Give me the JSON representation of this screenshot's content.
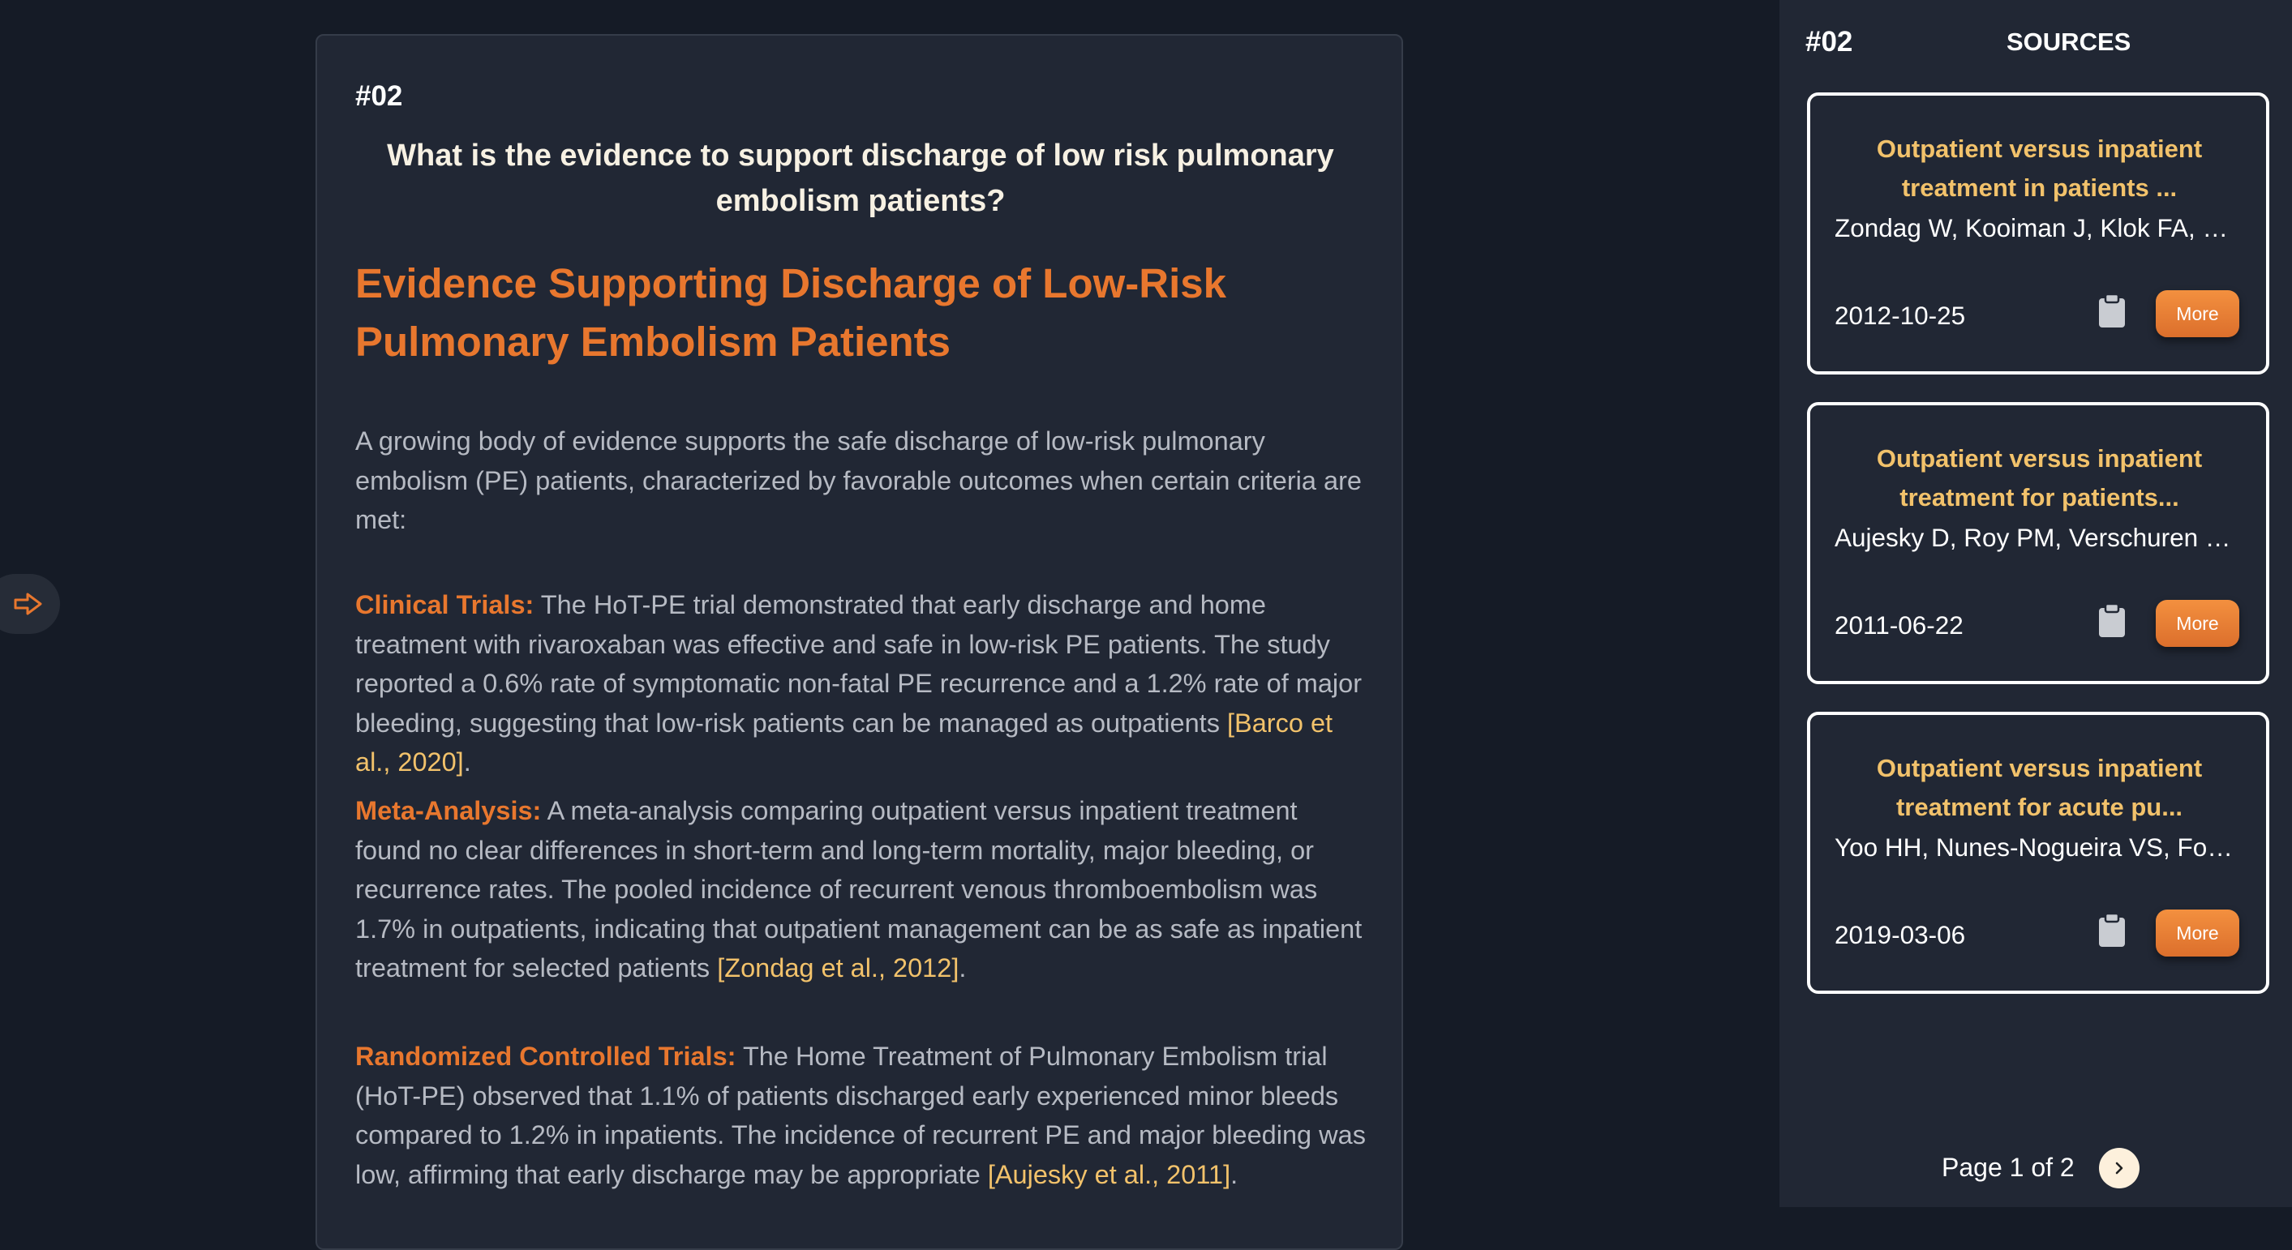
{
  "colors": {
    "accent": "#e8772e",
    "citation": "#f2c26b",
    "background": "#151b26",
    "panel": "#212734"
  },
  "answer": {
    "number": "#02",
    "question": "What is the evidence to support discharge of low risk pulmonary embolism patients?",
    "heading": "Evidence Supporting Discharge of Low-Risk Pulmonary Embolism Patients",
    "intro": "A growing body of evidence supports the safe discharge of low-risk pulmonary embolism (PE) patients, characterized by favorable outcomes when certain criteria are met:",
    "sections": [
      {
        "label": "Clinical Trials:",
        "text": " The HoT-PE trial demonstrated that early discharge and home treatment with rivaroxaban was effective and safe in low-risk PE patients. The study reported a 0.6% rate of symptomatic non-fatal PE recurrence and a 1.2% rate of major bleeding, suggesting that low-risk patients can be managed as outpatients ",
        "citation": "[Barco et al., 2020]",
        "end": "."
      },
      {
        "label": "Meta-Analysis:",
        "text": " A meta-analysis comparing outpatient versus inpatient treatment found no clear differences in short-term and long-term mortality, major bleeding, or recurrence rates. The pooled incidence of recurrent venous thromboembolism was 1.7% in outpatients, indicating that outpatient management can be as safe as inpatient treatment for selected patients ",
        "citation": "[Zondag et al., 2012]",
        "end": "."
      },
      {
        "label": "Randomized Controlled Trials:",
        "text": " The Home Treatment of Pulmonary Embolism trial (HoT-PE) observed that 1.1% of patients discharged early experienced minor bleeds compared to 1.2% in inpatients. The incidence of recurrent PE and major bleeding was low, affirming that early discharge may be appropriate ",
        "citation": "[Aujesky et al., 2011]",
        "end": "."
      }
    ]
  },
  "sidebar": {
    "number": "#02",
    "title": "SOURCES",
    "sources": [
      {
        "title": "Outpatient versus inpatient treatment in patients ...",
        "authors": "Zondag W, Kooiman J, Klok FA, De...",
        "date": "2012-10-25",
        "more_label": "More",
        "copy_icon": "clipboard-icon"
      },
      {
        "title": "Outpatient versus inpatient treatment for patients...",
        "authors": "Aujesky D, Roy PM, Verschuren F, ...",
        "date": "2011-06-22",
        "more_label": "More",
        "copy_icon": "clipboard-icon"
      },
      {
        "title": "Outpatient versus inpatient treatment for acute pu...",
        "authors": "Yoo HH, Nunes-Nogueira VS, Fort...",
        "date": "2019-03-06",
        "more_label": "More",
        "copy_icon": "clipboard-icon"
      }
    ],
    "pagination": {
      "label": "Page 1 of 2",
      "next_icon": "chevron-right-icon"
    }
  },
  "toggle": {
    "icon": "arrow-right-icon"
  }
}
